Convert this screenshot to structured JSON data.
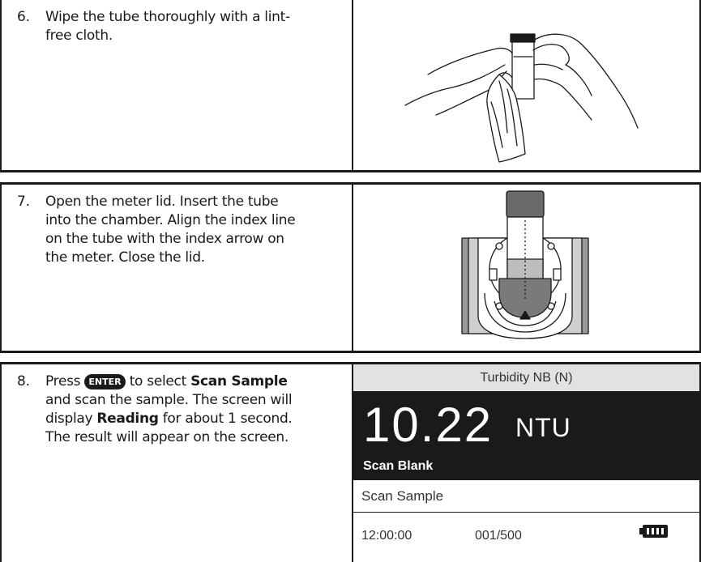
{
  "steps": [
    {
      "number": "6.",
      "text_line1": "Wipe the tube thoroughly with a lint-",
      "text_line2": "free cloth.",
      "illustration_icon": "hands-wiping-tube-illustration"
    },
    {
      "number": "7.",
      "text_line1": "Open the meter lid. Insert the tube",
      "text_line2": "into the chamber. Align the index line",
      "text_line3": "on the tube with the index arrow on",
      "text_line4": "the meter. Close the lid.",
      "illustration_icon": "tube-in-chamber-illustration"
    },
    {
      "number": "8.",
      "text_press": "Press",
      "enter_key_label": "ENTER",
      "text_to_select": "to select",
      "text_scan_sample": "Scan Sample",
      "text_line2": "and scan the sample. The screen will",
      "text_display": "display",
      "text_reading": "Reading",
      "text_for_about": "for about 1 second.",
      "text_line4": "The result will appear on the screen."
    }
  ],
  "meter_screen": {
    "title": "Turbidity NB (N)",
    "value": "10.22",
    "unit": "NTU",
    "selected_item": "Scan Blank",
    "menu_item": "Scan Sample",
    "time": "12:00:00",
    "count": "001/500",
    "battery_icon": "battery-full-icon"
  }
}
